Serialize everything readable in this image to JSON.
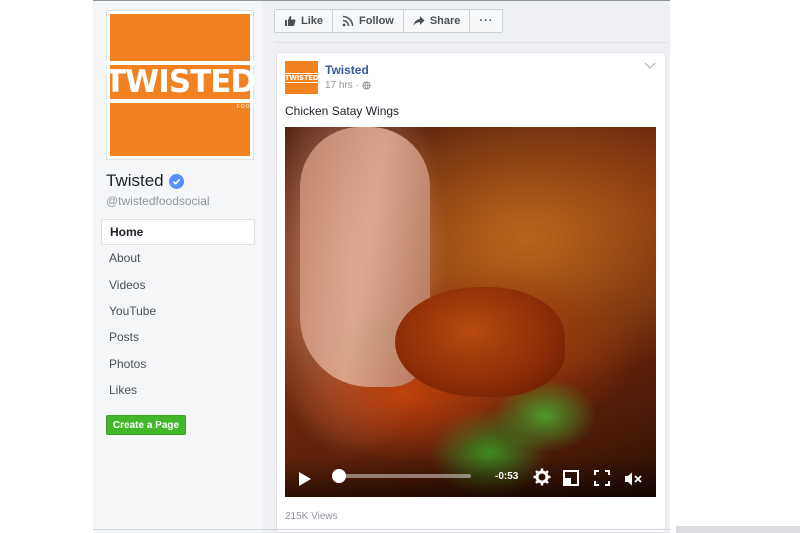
{
  "sidebar": {
    "logo_text": "TWISTED",
    "logo_subtext": "FOOD",
    "page_name": "Twisted",
    "handle": "@twistedfoodsocial",
    "nav": [
      "Home",
      "About",
      "Videos",
      "YouTube",
      "Posts",
      "Photos",
      "Likes"
    ],
    "create_page_label": "Create a Page"
  },
  "actions": {
    "like": "Like",
    "follow": "Follow",
    "share": "Share",
    "more": "···"
  },
  "post": {
    "avatar_text": "TWISTED",
    "author": "Twisted",
    "time": "17 hrs ·",
    "text": "Chicken Satay Wings",
    "video_time": "-0:53",
    "progress": 0.04,
    "views": "215K Views"
  },
  "colors": {
    "brand_orange": "#f18121",
    "link_blue": "#365899",
    "create_green": "#42b72a",
    "verified_blue": "#5890ff"
  }
}
